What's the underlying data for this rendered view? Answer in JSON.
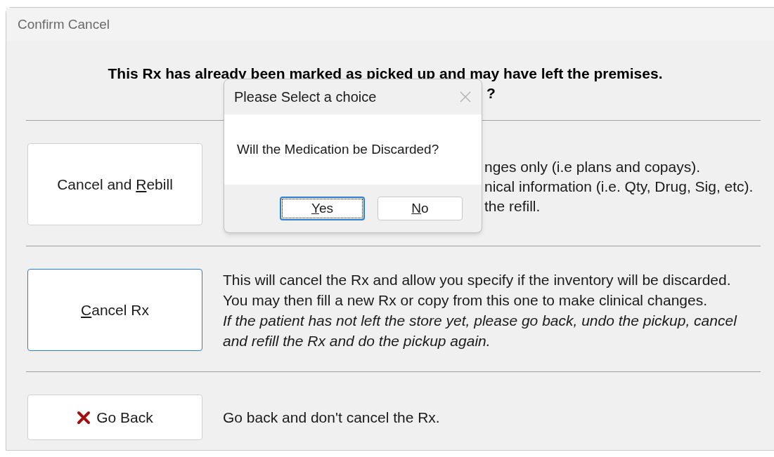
{
  "window": {
    "title": "Confirm Cancel"
  },
  "headline": {
    "line_1": "This Rx has already been marked as picked up and may have left the premises.",
    "line_2_visible": "?"
  },
  "options": [
    {
      "kind": "rebill",
      "button": {
        "label": {
          "before": "Cancel and ",
          "key": "R",
          "after": "ebill"
        },
        "focused": false
      },
      "visible_lines": [
        "nges only (i.e plans and copays).",
        "nical information (i.e. Qty, Drug, Sig, etc).",
        "the refill."
      ]
    },
    {
      "kind": "cancel",
      "button": {
        "label": {
          "key": "C",
          "after": "ancel Rx"
        },
        "focused": true
      },
      "lines": [
        "This will cancel the Rx and allow you specify if the inventory will be discarded.",
        "You may then fill a new Rx or copy from this one to make clinical changes."
      ],
      "note": "If the patient has not left the store yet, please go back, undo the pickup, cancel and refill the Rx and do the pickup again."
    },
    {
      "kind": "back",
      "button": {
        "label": {
          "after": "Go Back"
        },
        "focused": false
      },
      "lines": [
        "Go back and don't cancel the Rx."
      ]
    }
  ],
  "modal": {
    "title": "Please Select a choice",
    "message": "Will the Medication be Discarded?",
    "buttons": [
      {
        "label": {
          "key": "Y",
          "after": "es"
        },
        "focused": true
      },
      {
        "label": {
          "key": "N",
          "after": "o"
        },
        "focused": false
      }
    ]
  }
}
